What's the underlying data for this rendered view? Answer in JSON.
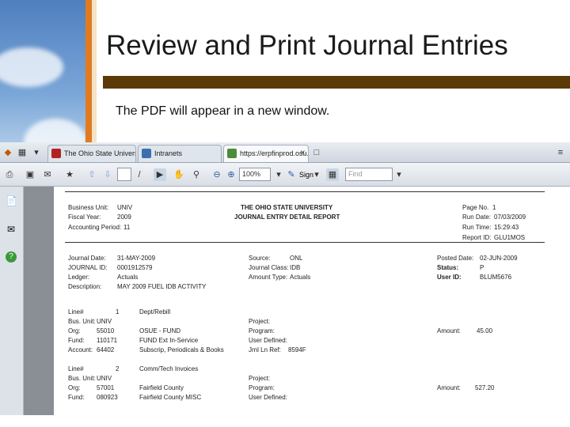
{
  "slide": {
    "title": "Review and Print Journal Entries",
    "body": "The PDF will appear in a new window."
  },
  "browser": {
    "tabs": [
      {
        "label": "The Ohio State University Ex..."
      },
      {
        "label": "Intranets"
      },
      {
        "label": "https://erpfinprod.osu.edu..."
      }
    ],
    "zoom_value": "100%",
    "sign_label": "Sign",
    "find_placeholder": "Find"
  },
  "report": {
    "header_left": [
      {
        "label": "Business Unit:",
        "value": "UNIV"
      },
      {
        "label": "Fiscal Year:",
        "value": "2009"
      },
      {
        "label": "Accounting Period:",
        "value": "11"
      }
    ],
    "title1": "THE OHIO STATE UNIVERSITY",
    "title2": "JOURNAL ENTRY DETAIL REPORT",
    "header_right": [
      {
        "label": "Page No.",
        "value": "1"
      },
      {
        "label": "Run Date:",
        "value": "07/03/2009"
      },
      {
        "label": "Run Time:",
        "value": "15:29:43"
      },
      {
        "label": "Report ID:",
        "value": "GLU1MOS"
      }
    ],
    "journal_left": [
      {
        "label": "Journal Date:",
        "value": "31-MAY-2009"
      },
      {
        "label": "JOURNAL ID:",
        "value": "0001912579"
      },
      {
        "label": "Ledger:",
        "value": "Actuals"
      },
      {
        "label": "Description:",
        "value": "MAY 2009 FUEL IDB ACTIVITY"
      }
    ],
    "journal_mid": [
      {
        "label": "Source:",
        "value": "ONL"
      },
      {
        "label": "Journal Class:",
        "value": "IDB"
      },
      {
        "label": "Amount Type:",
        "value": "Actuals"
      }
    ],
    "journal_right": [
      {
        "label": "Posted Date:",
        "value": "02-JUN-2009"
      },
      {
        "label": "Status:",
        "value": "P"
      },
      {
        "label": "User ID:",
        "value": "BLUM5676"
      }
    ],
    "line1": {
      "line_label": "Line#",
      "line_no": "1",
      "line_desc": "Dept/Rebill",
      "rows": [
        {
          "label": "Bus. Unit:",
          "value": "UNIV",
          "desc": "",
          "right_label": "Project:",
          "right_value": ""
        },
        {
          "label": "Org:",
          "value": "55010",
          "desc": "OSUE - FUND",
          "right_label": "Program:",
          "right_value": ""
        },
        {
          "label": "Fund:",
          "value": "110171",
          "desc": "FUND Ext In-Service",
          "right_label": "User Defined:",
          "right_value": ""
        },
        {
          "label": "Account:",
          "value": "64402",
          "desc": "Subscrip, Periodicals & Books",
          "right_label": "Jrnl Ln Ref:",
          "right_value": "8594F"
        }
      ],
      "amount_label": "Amount:",
      "amount_value": "45.00"
    },
    "line2": {
      "line_label": "Line#",
      "line_no": "2",
      "line_desc": "Comm/Tech Invoices",
      "rows": [
        {
          "label": "Bus. Unit:",
          "value": "UNIV",
          "desc": "",
          "right_label": "Project:",
          "right_value": ""
        },
        {
          "label": "Org:",
          "value": "57001",
          "desc": "Fairfield County",
          "right_label": "Program:",
          "right_value": ""
        },
        {
          "label": "Fund:",
          "value": "080923",
          "desc": "Fairfield County MISC",
          "right_label": "User Defined:",
          "right_value": ""
        }
      ],
      "amount_label": "Amount:",
      "amount_value": "527.20"
    },
    "colors": {
      "rule": "#5b3a08",
      "accent": "#e07b21"
    }
  }
}
